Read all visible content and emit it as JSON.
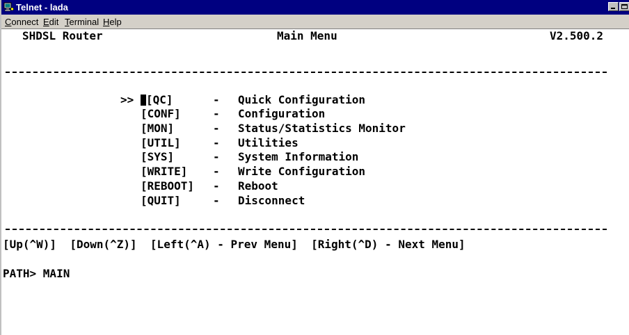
{
  "window": {
    "title": "Telnet - lada",
    "icon": "telnet-app-icon"
  },
  "menubar": {
    "items": [
      {
        "label": "Connect",
        "mnemonic": "C",
        "rest": "onnect"
      },
      {
        "label": "Edit",
        "mnemonic": "E",
        "rest": "dit"
      },
      {
        "label": "Terminal",
        "mnemonic": "T",
        "rest": "erminal"
      },
      {
        "label": "Help",
        "mnemonic": "H",
        "rest": "elp"
      }
    ]
  },
  "terminal": {
    "header": {
      "left": "SHDSL Router",
      "center": "Main Menu",
      "right": "V2.500.2"
    },
    "selection_marker": ">>",
    "menu": [
      {
        "key": "[QC]",
        "sep": "-",
        "desc": "Quick Configuration",
        "selected": true
      },
      {
        "key": "[CONF]",
        "sep": "-",
        "desc": "Configuration"
      },
      {
        "key": "[MON]",
        "sep": "-",
        "desc": "Status/Statistics Monitor"
      },
      {
        "key": "[UTIL]",
        "sep": "-",
        "desc": "Utilities"
      },
      {
        "key": "[SYS]",
        "sep": "-",
        "desc": "System Information"
      },
      {
        "key": "[WRITE]",
        "sep": "-",
        "desc": "Write Configuration"
      },
      {
        "key": "[REBOOT]",
        "sep": "-",
        "desc": "Reboot"
      },
      {
        "key": "[QUIT]",
        "sep": "-",
        "desc": "Disconnect"
      }
    ],
    "nav_hint": "[Up(^W)]  [Down(^Z)]  [Left(^A) - Prev Menu]  [Right(^D) - Next Menu]",
    "path": "PATH> MAIN"
  },
  "colors": {
    "titlebar": "#000080",
    "menubar": "#d4d0c8",
    "terminal_bg": "#ffffff",
    "terminal_fg": "#000000"
  }
}
